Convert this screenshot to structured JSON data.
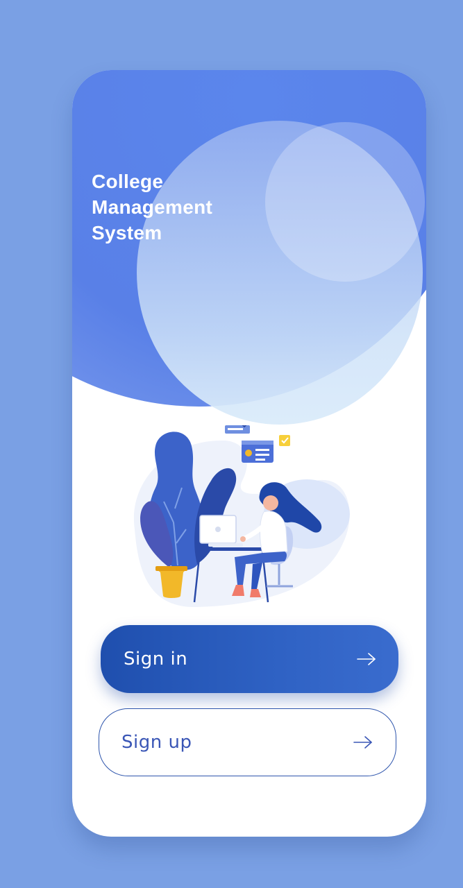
{
  "app": {
    "title_lines": [
      "College",
      "Management",
      "System"
    ]
  },
  "actions": {
    "sign_in_label": "Sign in",
    "sign_up_label": "Sign up"
  },
  "icons": {
    "sign_in_arrow": "arrow-right-icon",
    "sign_up_arrow": "arrow-right-icon"
  },
  "colors": {
    "background": "#7aa0e4",
    "primary": "#2455b6",
    "hero_blue": "#5980e7",
    "card": "#ffffff"
  }
}
